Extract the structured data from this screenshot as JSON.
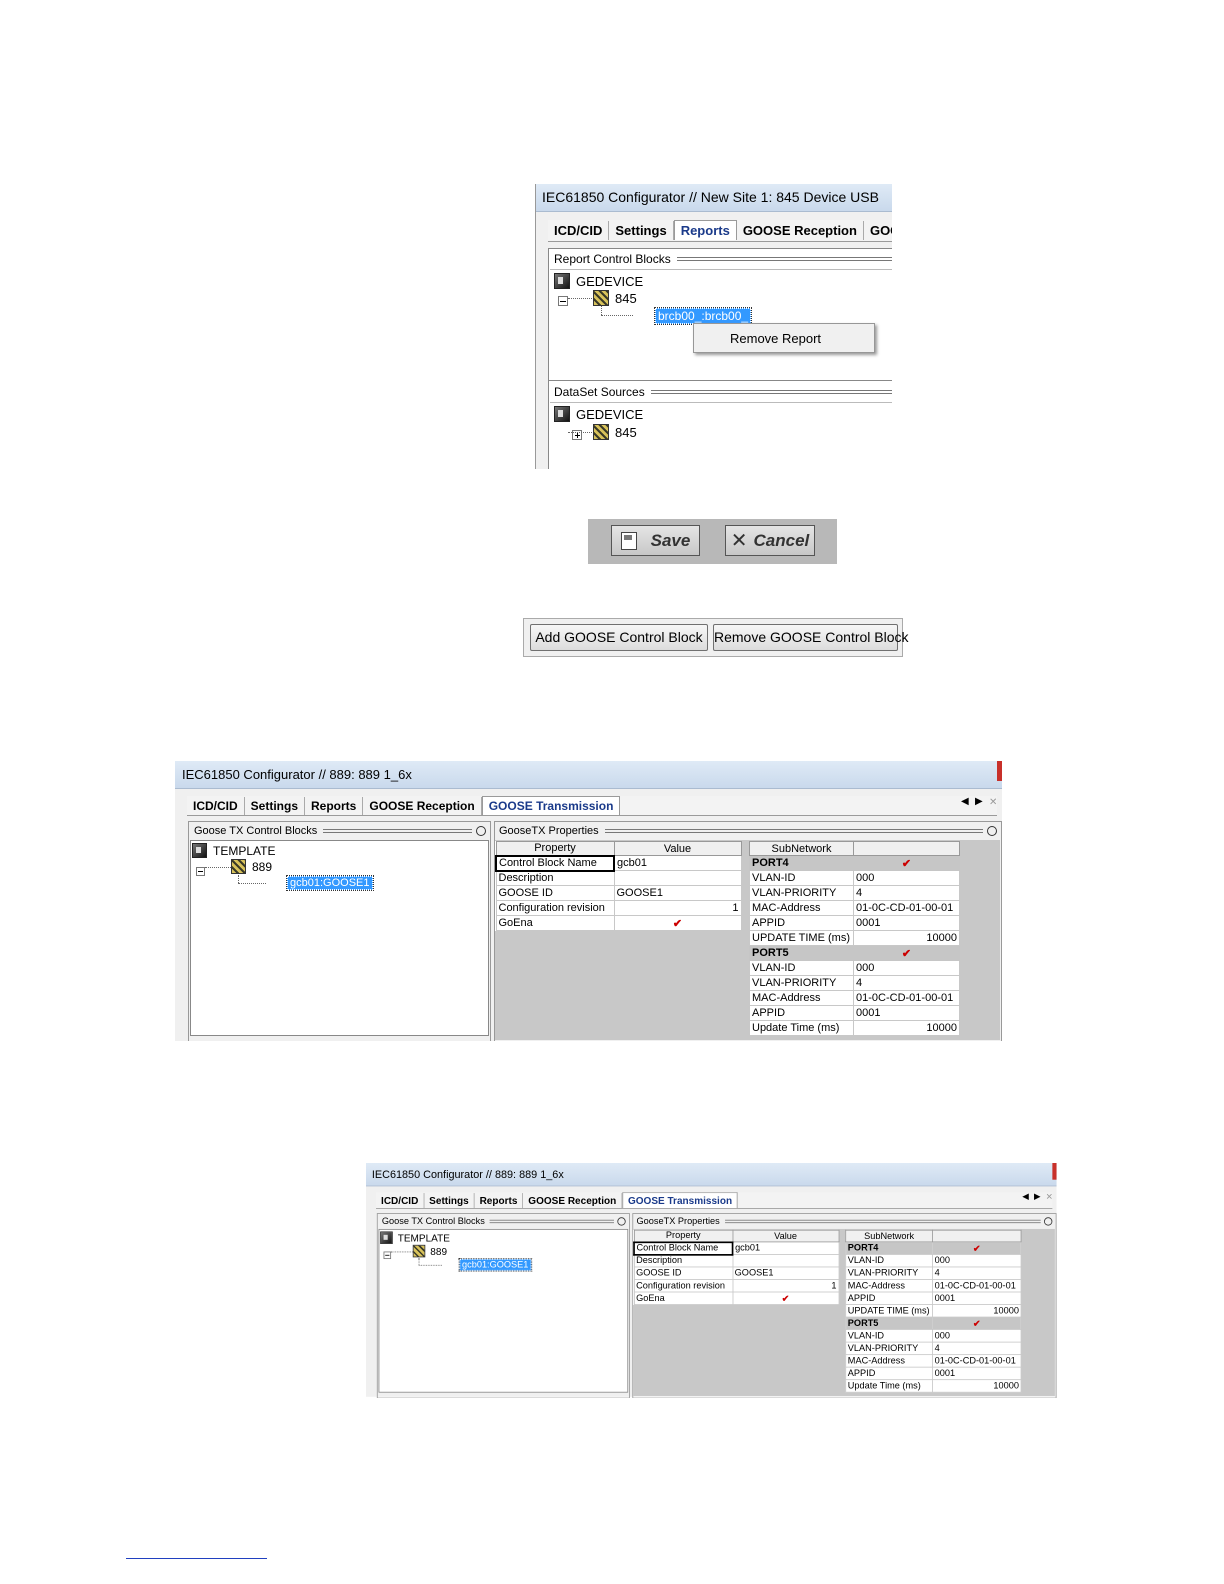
{
  "fig1": {
    "title": "IEC61850 Configurator // New Site 1: 845 Device USB",
    "tabs": [
      "ICD/CID",
      "Settings",
      "Reports",
      "GOOSE Reception",
      "GOOS"
    ],
    "report_control_blocks": {
      "header": "Report Control Blocks",
      "root": "GEDEVICE",
      "child": "845",
      "selected": "brcb00_:brcb00_"
    },
    "context_menu": {
      "item": "Remove Report"
    },
    "dataset_sources": {
      "header": "DataSet Sources",
      "root": "GEDEVICE",
      "child": "845"
    }
  },
  "fig2": {
    "save_label": "Save",
    "cancel_label": "Cancel"
  },
  "fig3": {
    "add_label": "Add GOOSE Control Block",
    "remove_label": "Remove GOOSE Control Block"
  },
  "goose": {
    "title": "IEC61850 Configurator // 889: 889 1_6x",
    "tabs": [
      "ICD/CID",
      "Settings",
      "Reports",
      "GOOSE Reception",
      "GOOSE Transmission"
    ],
    "left_header": "Goose TX Control Blocks",
    "tree_root": "TEMPLATE",
    "tree_child": "889",
    "tree_selected": "gcb01:GOOSE1",
    "props_header": "GooseTX Properties",
    "props_columns": [
      "Property",
      "Value"
    ],
    "props": [
      {
        "property": "Control Block Name",
        "value": "gcb01"
      },
      {
        "property": "Description",
        "value": ""
      },
      {
        "property": "GOOSE ID",
        "value": "GOOSE1"
      },
      {
        "property": "Configuration revision",
        "value": "1"
      },
      {
        "property": "GoEna",
        "value": "✔"
      }
    ],
    "subnet_columns": [
      "SubNetwork",
      ""
    ],
    "port4": {
      "name": "PORT4",
      "check": "✔",
      "rows": [
        {
          "k": "VLAN-ID",
          "v": "000"
        },
        {
          "k": "VLAN-PRIORITY",
          "v": "4"
        },
        {
          "k": "MAC-Address",
          "v": "01-0C-CD-01-00-01"
        },
        {
          "k": "APPID",
          "v": "0001"
        },
        {
          "k": "UPDATE TIME (ms)",
          "v": "10000"
        }
      ]
    },
    "port5": {
      "name": "PORT5",
      "check": "✔",
      "rows": [
        {
          "k": "VLAN-ID",
          "v": "000"
        },
        {
          "k": "VLAN-PRIORITY",
          "v": "4"
        },
        {
          "k": "MAC-Address",
          "v": "01-0C-CD-01-00-01"
        },
        {
          "k": "APPID",
          "v": "0001"
        },
        {
          "k": "Update Time (ms)",
          "v": "10000"
        }
      ]
    }
  }
}
